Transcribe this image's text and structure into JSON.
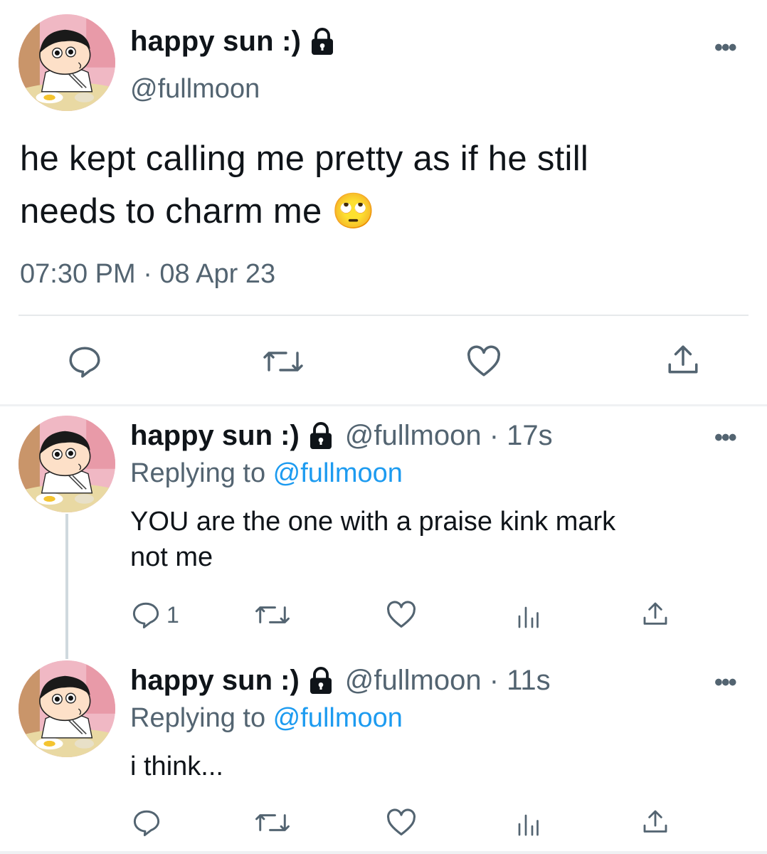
{
  "main_tweet": {
    "display_name": "happy sun :)",
    "handle": "@fullmoon",
    "text_line1": "he kept calling me pretty as if he still",
    "text_line2": "needs to charm me 🙄",
    "timestamp": "07:30 PM · 08 Apr 23"
  },
  "replies": [
    {
      "display_name": "happy sun :)",
      "handle_time": "@fullmoon · 17s",
      "replying_prefix": "Replying to ",
      "replying_to": "@fullmoon",
      "text_line1": "YOU are the one with a praise kink mark",
      "text_line2": "not me",
      "reply_count": "1"
    },
    {
      "display_name": "happy sun :)",
      "handle_time": "@fullmoon · 11s",
      "replying_prefix": "Replying to ",
      "replying_to": "@fullmoon",
      "text_line1": "i think..."
    }
  ],
  "more_label": "•••",
  "icons": [
    "lock-icon",
    "reply-icon",
    "retweet-icon",
    "like-icon",
    "share-icon",
    "analytics-icon",
    "more-icon"
  ],
  "colors": {
    "link": "#1d9bf0",
    "secondary_text": "#536471",
    "text": "#0f1419"
  }
}
